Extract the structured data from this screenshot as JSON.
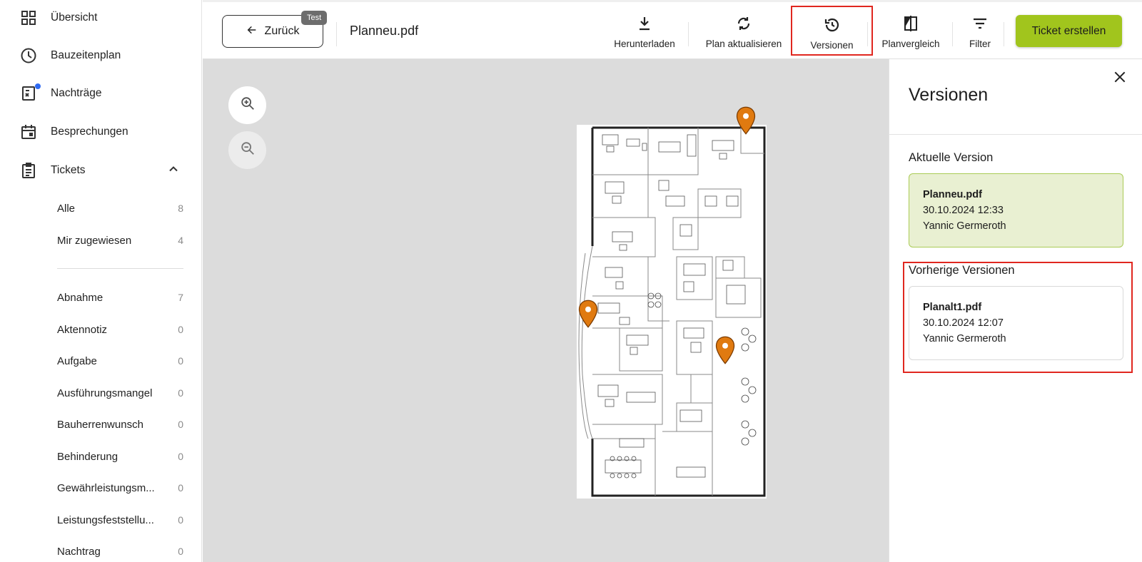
{
  "sidebar": {
    "items": [
      {
        "label": "Übersicht",
        "icon": "grid-icon"
      },
      {
        "label": "Bauzeitenplan",
        "icon": "clock-icon"
      },
      {
        "label": "Nachträge",
        "icon": "document-change-icon",
        "badge": true
      },
      {
        "label": "Besprechungen",
        "icon": "calendar-icon"
      },
      {
        "label": "Tickets",
        "icon": "clipboard-icon",
        "expanded": true
      }
    ],
    "ticket_filters": [
      {
        "label": "Alle",
        "count": "8"
      },
      {
        "label": "Mir zugewiesen",
        "count": "4"
      }
    ],
    "ticket_types": [
      {
        "label": "Abnahme",
        "count": "7"
      },
      {
        "label": "Aktennotiz",
        "count": "0"
      },
      {
        "label": "Aufgabe",
        "count": "0"
      },
      {
        "label": "Ausführungsmangel",
        "count": "0"
      },
      {
        "label": "Bauherrenwunsch",
        "count": "0"
      },
      {
        "label": "Behinderung",
        "count": "0"
      },
      {
        "label": "Gewährleistungsm...",
        "count": "0"
      },
      {
        "label": "Leistungsfeststellu...",
        "count": "0"
      },
      {
        "label": "Nachtrag",
        "count": "0"
      }
    ]
  },
  "header": {
    "back_label": "Zurück",
    "test_tag": "Test",
    "file_name": "Planneu.pdf",
    "tools": [
      {
        "label": "Herunterladen",
        "icon": "download-icon"
      },
      {
        "label": "Plan aktualisieren",
        "icon": "sync-icon"
      },
      {
        "label": "Versionen",
        "icon": "history-icon",
        "active": true
      },
      {
        "label": "Planvergleich",
        "icon": "compare-icon"
      },
      {
        "label": "Filter",
        "icon": "filter-icon"
      }
    ],
    "ticket_button": "Ticket erstellen"
  },
  "canvas": {
    "zoom_in": "zoom-in-icon",
    "zoom_out": "zoom-out-icon",
    "pin_color": "#e07a10"
  },
  "versions_panel": {
    "title": "Versionen",
    "current_heading": "Aktuelle Version",
    "current": {
      "name": "Planneu.pdf",
      "date": "30.10.2024 12:33",
      "author": "Yannic Germeroth"
    },
    "previous_heading": "Vorherige Versionen",
    "previous": [
      {
        "name": "Planalt1.pdf",
        "date": "30.10.2024 12:07",
        "author": "Yannic Germeroth"
      }
    ]
  },
  "colors": {
    "accent_green": "#a1c51d",
    "highlight_red": "#e0271f",
    "current_card_bg": "#e9f0d2"
  }
}
